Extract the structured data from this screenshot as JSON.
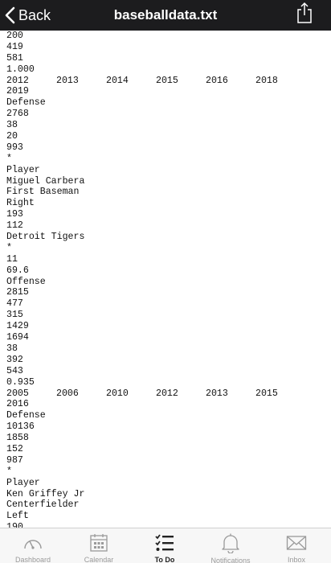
{
  "navbar": {
    "back_label": "Back",
    "title": "baseballdata.txt",
    "back_icon": "chevron-left-icon",
    "share_icon": "share-icon"
  },
  "file_lines": [
    "200",
    "419",
    "581",
    "1.000",
    [
      "2012",
      "2013",
      "2014",
      "2015",
      "2016",
      "2018"
    ],
    "2019",
    "Defense",
    "2768",
    "38",
    "20",
    "993",
    "*",
    "Player",
    "Miguel Carbera",
    "First Baseman",
    "Right",
    "193",
    "112",
    "Detroit Tigers",
    "*",
    "11",
    "69.6",
    "Offense",
    "2815",
    "477",
    "315",
    "1429",
    "1694",
    "38",
    "392",
    "543",
    "0.935",
    [
      "2005",
      "2006",
      "2010",
      "2012",
      "2013",
      "2015"
    ],
    "2016",
    "Defense",
    "10136",
    "1858",
    "152",
    "987",
    "*",
    "Player",
    "Ken Griffey Jr",
    "Centerfielder",
    "Left",
    "190"
  ],
  "tabbar": {
    "items": [
      {
        "label": "Dashboard",
        "icon": "gauge-icon",
        "active": false
      },
      {
        "label": "Calendar",
        "icon": "calendar-icon",
        "active": false
      },
      {
        "label": "To Do",
        "icon": "checklist-icon",
        "active": true
      },
      {
        "label": "Notifications",
        "icon": "bell-icon",
        "active": false
      },
      {
        "label": "Inbox",
        "icon": "envelope-icon",
        "active": false
      }
    ]
  },
  "colors": {
    "navbar_bg": "#1c1c1e",
    "tab_inactive": "#9a9a9a",
    "tab_active": "#222222"
  }
}
